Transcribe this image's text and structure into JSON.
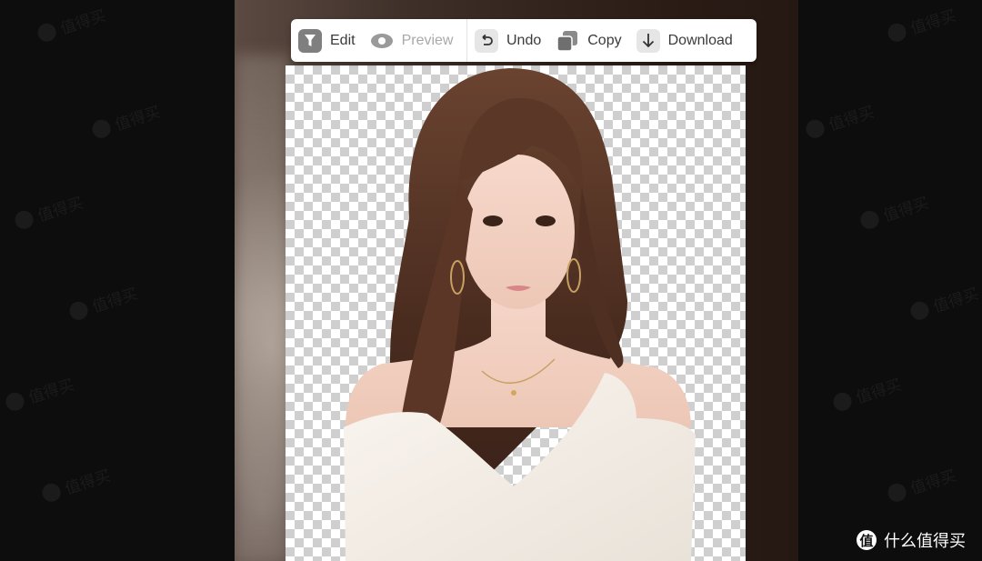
{
  "toolbar": {
    "edit_label": "Edit",
    "preview_label": "Preview",
    "undo_label": "Undo",
    "copy_label": "Copy",
    "download_label": "Download",
    "icons": {
      "edit": "funnel-icon",
      "preview": "eye-icon",
      "undo": "undo-icon",
      "copy": "copy-icon",
      "download": "download-icon"
    }
  },
  "canvas": {
    "background": "transparent-checkerboard",
    "subject": "cut-out portrait of a woman in a white top"
  },
  "watermark": {
    "text": "值得买"
  },
  "brand": {
    "logo_glyph": "值",
    "name": "什么值得买"
  },
  "colors": {
    "page_background": "#0d0d0d",
    "toolbar_background": "#ffffff",
    "toolbar_text": "#3a3a3a",
    "disabled_text": "#a9a9a9",
    "checker_dark": "#cfcfcf"
  }
}
